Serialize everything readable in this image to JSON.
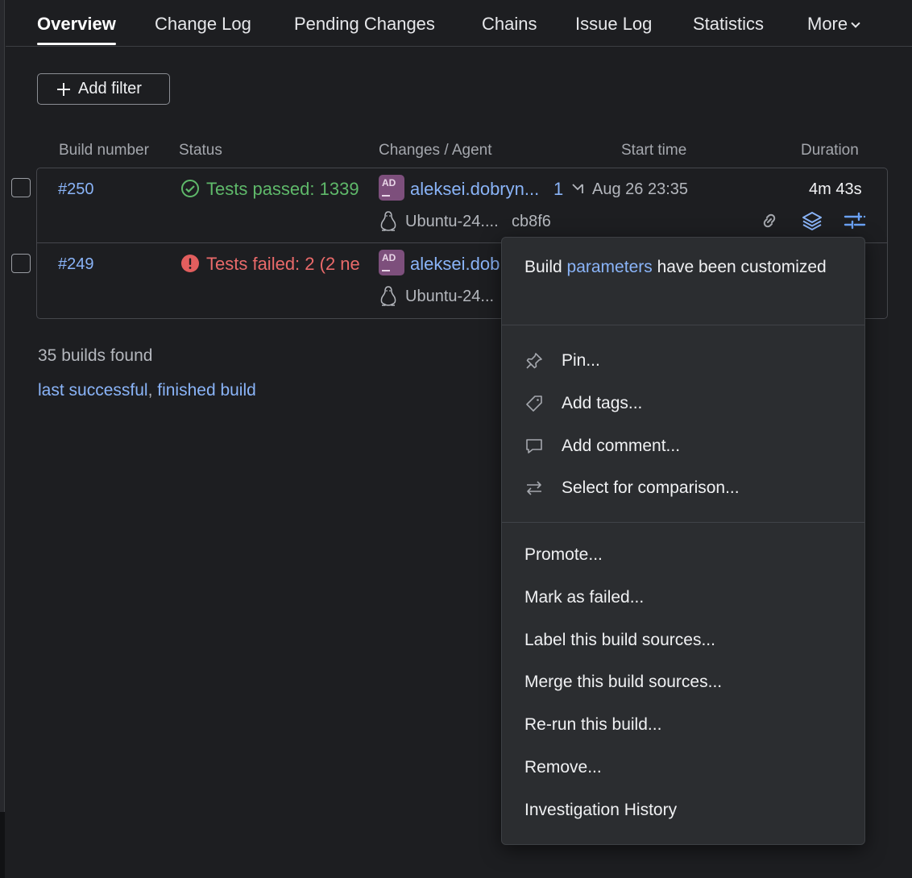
{
  "tabs": [
    {
      "label": "Overview"
    },
    {
      "label": "Change Log"
    },
    {
      "label": "Pending Changes"
    },
    {
      "label": "Chains"
    },
    {
      "label": "Issue Log"
    },
    {
      "label": "Statistics"
    },
    {
      "label": "More"
    }
  ],
  "filter": {
    "add_label": "Add filter"
  },
  "columns": {
    "build_number": "Build number",
    "status": "Status",
    "changes_agent": "Changes / Agent",
    "start_time": "Start time",
    "duration": "Duration"
  },
  "builds": [
    {
      "number": "#250",
      "status": "Tests passed: 1339",
      "avatar": "AD",
      "author": "aleksei.dobryn...",
      "change_count": "1",
      "agent": "Ubuntu-24....",
      "revision": "cb8f6",
      "start_time": "Aug 26 23:35",
      "duration": "4m 43s"
    },
    {
      "number": "#249",
      "status": "Tests failed: 2 (2 ne",
      "avatar": "AD",
      "author": "aleksei.dob",
      "agent": "Ubuntu-24..."
    }
  ],
  "summary": {
    "found": "35 builds found",
    "link1": "last successful",
    "separator": ", ",
    "link2": "finished build"
  },
  "menu": {
    "note_prefix": "Build ",
    "note_link": "parameters",
    "note_suffix": " have been customized",
    "group1": [
      {
        "label": "Pin...",
        "icon": "pin-icon"
      },
      {
        "label": "Add tags...",
        "icon": "tag-icon"
      },
      {
        "label": "Add comment...",
        "icon": "comment-icon"
      },
      {
        "label": "Select for comparison...",
        "icon": "compare-arrows-icon"
      }
    ],
    "group2": [
      {
        "label": "Promote..."
      },
      {
        "label": "Mark as failed..."
      },
      {
        "label": "Label this build sources..."
      },
      {
        "label": "Merge this build sources..."
      },
      {
        "label": "Re-run this build..."
      },
      {
        "label": "Remove..."
      },
      {
        "label": "Investigation History"
      }
    ]
  },
  "colors": {
    "background": "#1d1e21",
    "link": "#8ab4f8",
    "success": "#5fb96a",
    "failure": "#ea6a6a",
    "avatar": "#7d4f7c",
    "menu_bg": "#2b2d30"
  }
}
